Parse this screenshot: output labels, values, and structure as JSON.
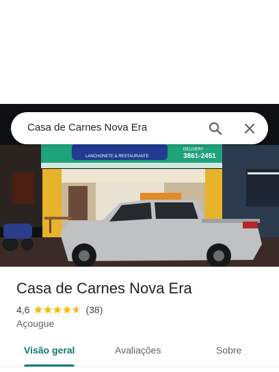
{
  "search": {
    "query": "Casa de Carnes Nova Era"
  },
  "place": {
    "name": "Casa de Carnes Nova Era",
    "rating": "4,6",
    "stars": 4.6,
    "reviews": "(38)",
    "category": "Açougue"
  },
  "photo_signage": {
    "delivery_label": "DELIVERY",
    "phone": "3861-2451",
    "sub": "LANCHONETE & RESTAURANTE"
  },
  "tabs": [
    {
      "label": "Visão geral"
    },
    {
      "label": "Avaliações"
    },
    {
      "label": "Sobre"
    }
  ],
  "colors": {
    "accent": "#0b7a6f",
    "star": "#fbbc04"
  },
  "icons": {
    "search": "search-icon",
    "close": "close-icon"
  }
}
